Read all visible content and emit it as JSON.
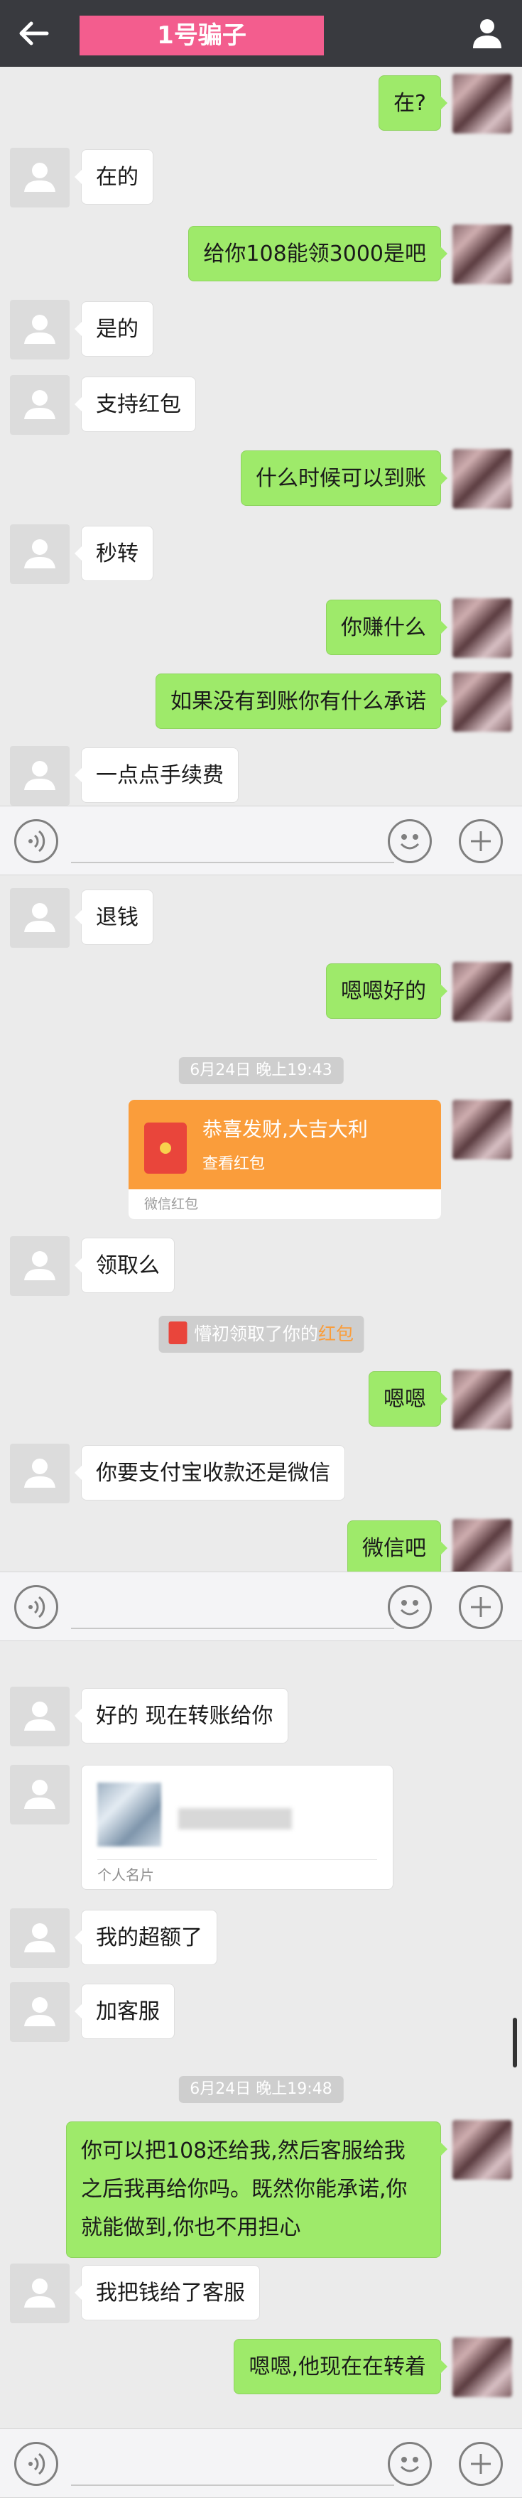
{
  "header": {
    "title": "1号骗子"
  },
  "timestamps": [
    "6月24日 晚上19:43",
    "6月24日 晚上19:48"
  ],
  "messages": {
    "m1": "在?",
    "m2": "在的",
    "m3": "给你108能领3000是吧",
    "m4": "是的",
    "m5": "支持红包",
    "m6": "什么时候可以到账",
    "m7": "秒转",
    "m8": "你赚什么",
    "m9": "如果没有到账你有什么承诺",
    "m10": "一点点手续费",
    "m11": "退钱",
    "m12": "嗯嗯好的",
    "m13": "领取么",
    "m14": "嗯嗯",
    "m15": "你要支付宝收款还是微信",
    "m16": "微信吧",
    "m17": "好的 现在转账给你",
    "m18": "我的超额了",
    "m19": "加客服",
    "m20": "你可以把108还给我,然后客服给我之后我再给你吗。既然你能承诺,你就能做到,你也不用担心",
    "m21": "我把钱给了客服",
    "m22": "嗯嗯,他现在在转着"
  },
  "red_packet": {
    "title": "恭喜发财,大吉大利",
    "subtitle": "查看红包",
    "footer": "微信红包"
  },
  "notice": {
    "prefix": "懵初领取了你的",
    "link": "红包"
  },
  "card": {
    "label": "个人名片"
  },
  "icons": {
    "back": "back-arrow-icon",
    "profile": "person-icon",
    "voice": "voice-icon",
    "emoji": "emoji-icon",
    "plus": "plus-icon"
  },
  "colors": {
    "topbar": "#393a3f",
    "title_bg": "#f35d8e",
    "bubble_green": "#9eea6a",
    "redpacket_orange": "#fa9d3b"
  }
}
